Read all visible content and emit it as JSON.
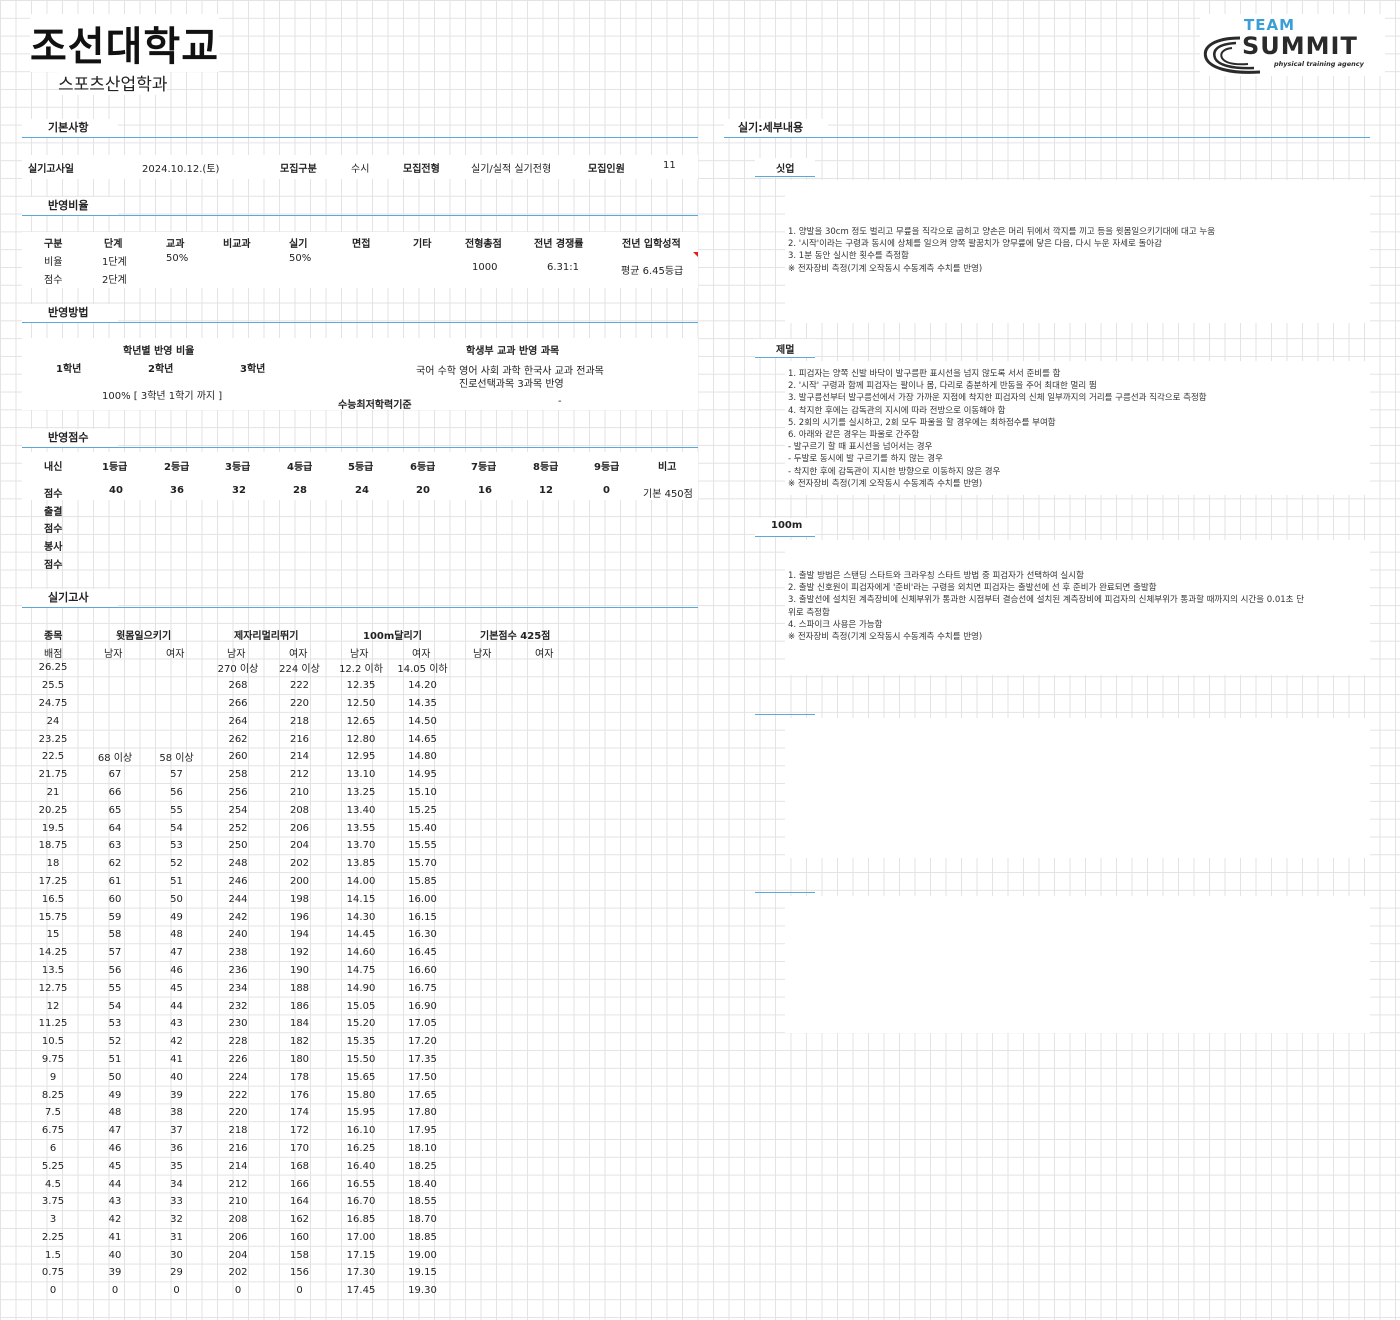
{
  "header": {
    "university": "조선대학교",
    "department": "스포츠산업학과",
    "logo": {
      "team": "TEAM",
      "summit": "SUMMIT",
      "tagline": "physical training agency"
    }
  },
  "basic": {
    "section_title": "기본사항",
    "exam_date_label": "실기고사일",
    "exam_date": "2024.10.12.(토)",
    "recruit_type_label": "모집구분",
    "recruit_type": "수시",
    "admission_label": "모집전형",
    "admission": "실기/실적 실기전형",
    "quota_label": "모집인원",
    "quota": "11"
  },
  "ratio": {
    "section_title": "반영비율",
    "headers": [
      "구분",
      "단계",
      "교과",
      "비교과",
      "실기",
      "면접",
      "기타",
      "전형총점",
      "전년 경쟁률",
      "전년 입학성적"
    ],
    "row1": {
      "label": "비율",
      "stage": "1단계",
      "subject": "50%",
      "practical": "50%"
    },
    "row2": {
      "label": "점수",
      "stage": "2단계"
    },
    "total": "1000",
    "competition": "6.31:1",
    "prev_score": "평균 6.45등급"
  },
  "method": {
    "section_title": "반영방법",
    "grade_ratio_title": "학년별 반영 비율",
    "grade1": "1학년",
    "grade2": "2학년",
    "grade3": "3학년",
    "grade_ratio_value": "100% [ 3학년 1학기 까지 ]",
    "subject_title": "학생부 교과 반영 과목",
    "subject_line1": "국어 수학 영어 사회 과학 한국사 교과 전과목",
    "subject_line2": "진로선택과목 3과목 반영",
    "csat_label": "수능최저학력기준",
    "csat_value": "-"
  },
  "points": {
    "section_title": "반영점수",
    "headers": [
      "내신",
      "1등급",
      "2등급",
      "3등급",
      "4등급",
      "5등급",
      "6등급",
      "7등급",
      "8등급",
      "9등급",
      "비고"
    ],
    "score_label": "점수",
    "scores": [
      "40",
      "36",
      "32",
      "28",
      "24",
      "20",
      "16",
      "12",
      "0"
    ],
    "note": "기본 450점",
    "attendance_label": "출결",
    "attendance_score_label": "점수",
    "service_label": "봉사",
    "service_score_label": "점수"
  },
  "practical": {
    "section_title": "실기고사",
    "col_event": "종목",
    "event1": "윗몸일으키기",
    "event2": "제자리멀리뛰기",
    "event3": "100m달리기",
    "base_score": "기본점수 425점",
    "col_score": "배점",
    "male": "남자",
    "female": "여자",
    "rows": [
      [
        "26.25",
        "",
        "",
        "270 이상",
        "224 이상",
        "12.2 이하",
        "14.05 이하"
      ],
      [
        "25.5",
        "",
        "",
        "268",
        "222",
        "12.35",
        "14.20"
      ],
      [
        "24.75",
        "",
        "",
        "266",
        "220",
        "12.50",
        "14.35"
      ],
      [
        "24",
        "",
        "",
        "264",
        "218",
        "12.65",
        "14.50"
      ],
      [
        "23.25",
        "",
        "",
        "262",
        "216",
        "12.80",
        "14.65"
      ],
      [
        "22.5",
        "68 이상",
        "58 이상",
        "260",
        "214",
        "12.95",
        "14.80"
      ],
      [
        "21.75",
        "67",
        "57",
        "258",
        "212",
        "13.10",
        "14.95"
      ],
      [
        "21",
        "66",
        "56",
        "256",
        "210",
        "13.25",
        "15.10"
      ],
      [
        "20.25",
        "65",
        "55",
        "254",
        "208",
        "13.40",
        "15.25"
      ],
      [
        "19.5",
        "64",
        "54",
        "252",
        "206",
        "13.55",
        "15.40"
      ],
      [
        "18.75",
        "63",
        "53",
        "250",
        "204",
        "13.70",
        "15.55"
      ],
      [
        "18",
        "62",
        "52",
        "248",
        "202",
        "13.85",
        "15.70"
      ],
      [
        "17.25",
        "61",
        "51",
        "246",
        "200",
        "14.00",
        "15.85"
      ],
      [
        "16.5",
        "60",
        "50",
        "244",
        "198",
        "14.15",
        "16.00"
      ],
      [
        "15.75",
        "59",
        "49",
        "242",
        "196",
        "14.30",
        "16.15"
      ],
      [
        "15",
        "58",
        "48",
        "240",
        "194",
        "14.45",
        "16.30"
      ],
      [
        "14.25",
        "57",
        "47",
        "238",
        "192",
        "14.60",
        "16.45"
      ],
      [
        "13.5",
        "56",
        "46",
        "236",
        "190",
        "14.75",
        "16.60"
      ],
      [
        "12.75",
        "55",
        "45",
        "234",
        "188",
        "14.90",
        "16.75"
      ],
      [
        "12",
        "54",
        "44",
        "232",
        "186",
        "15.05",
        "16.90"
      ],
      [
        "11.25",
        "53",
        "43",
        "230",
        "184",
        "15.20",
        "17.05"
      ],
      [
        "10.5",
        "52",
        "42",
        "228",
        "182",
        "15.35",
        "17.20"
      ],
      [
        "9.75",
        "51",
        "41",
        "226",
        "180",
        "15.50",
        "17.35"
      ],
      [
        "9",
        "50",
        "40",
        "224",
        "178",
        "15.65",
        "17.50"
      ],
      [
        "8.25",
        "49",
        "39",
        "222",
        "176",
        "15.80",
        "17.65"
      ],
      [
        "7.5",
        "48",
        "38",
        "220",
        "174",
        "15.95",
        "17.80"
      ],
      [
        "6.75",
        "47",
        "37",
        "218",
        "172",
        "16.10",
        "17.95"
      ],
      [
        "6",
        "46",
        "36",
        "216",
        "170",
        "16.25",
        "18.10"
      ],
      [
        "5.25",
        "45",
        "35",
        "214",
        "168",
        "16.40",
        "18.25"
      ],
      [
        "4.5",
        "44",
        "34",
        "212",
        "166",
        "16.55",
        "18.40"
      ],
      [
        "3.75",
        "43",
        "33",
        "210",
        "164",
        "16.70",
        "18.55"
      ],
      [
        "3",
        "42",
        "32",
        "208",
        "162",
        "16.85",
        "18.70"
      ],
      [
        "2.25",
        "41",
        "31",
        "206",
        "160",
        "17.00",
        "18.85"
      ],
      [
        "1.5",
        "40",
        "30",
        "204",
        "158",
        "17.15",
        "19.00"
      ],
      [
        "0.75",
        "39",
        "29",
        "202",
        "156",
        "17.30",
        "19.15"
      ],
      [
        "0",
        "0",
        "0",
        "0",
        "0",
        "17.45",
        "19.30"
      ]
    ]
  },
  "details": {
    "section_title": "실기:세부내용",
    "situp_title": "싯업",
    "situp_lines": [
      "1. 양발을 30cm 정도 벌리고 무릎을 직각으로 굽히고 양손은 머리 뒤에서 깍지를 끼고 등을 윗몸일으키기대에 대고 누움",
      "2. '시작'이라는 구령과 동시에 상체를 일으켜 양쪽 팔꿈치가 양무릎에 닿은 다음, 다시 누운 자세로 돌아감",
      "3. 1분 동안 실시한 횟수를 측정함",
      "※ 전자장비 측정(기계 오작동시 수동계측 수치를 반영)"
    ],
    "jump_title": "제멀",
    "jump_lines": [
      "1. 피검자는 양쪽 신발 바닥이 발구름판 표시선을 넘지 않도록 서서 준비를 함",
      "2. '시작' 구령과 함께 피검자는 팔이나 몸, 다리로 충분하게 반동을 주어 최대한 멀리 뜀",
      "3. 발구름선부터 발구름선에서 가장 가까운 지점에 착지한 피검자의 신체 일부까지의 거리를 구름선과 직각으로 측정함",
      "4. 착지한 후에는 감독관의 지시에 따라 전방으로 이동해야 함",
      "5. 2회의 시기를 실시하고, 2회 모두 파울을 할 경우에는 최하점수를 부여함",
      "6. 아래와 같은 경우는 파울로 간주함",
      " - 발구르기 할 때 표시선을 넘어서는 경우",
      " - 두발로 동시에 발 구르기를 하지 않는 경우",
      " - 착지한 후에 감독관이 지시한 방향으로 이동하지 않은 경우",
      "※ 전자장비 측정(기계 오작동시 수동계측 수치를 반영)"
    ],
    "run_title": "100m",
    "run_lines": [
      "1. 출발 방법은 스탠딩 스타트와 크라우칭 스타트 방법 중 피검자가 선택하여 실시함",
      "2. 출발 신호원이 피검자에게 '준비'라는 구령을 외치면 피검자는 출발선에 선 후 준비가 완료되면 출발함",
      "3. 출발선에 설치된 계측장비에 신체부위가 통과한 시점부터 결승선에 설치된 계측장비에 피검자의 신체부위가 통과할 때까지의 시간을 0.01초 단",
      "위로 측정함",
      "4. 스파이크 사용은 가능함",
      "※ 전자장비 측정(기계 오작동시 수동계측 수치를 반영)"
    ]
  }
}
